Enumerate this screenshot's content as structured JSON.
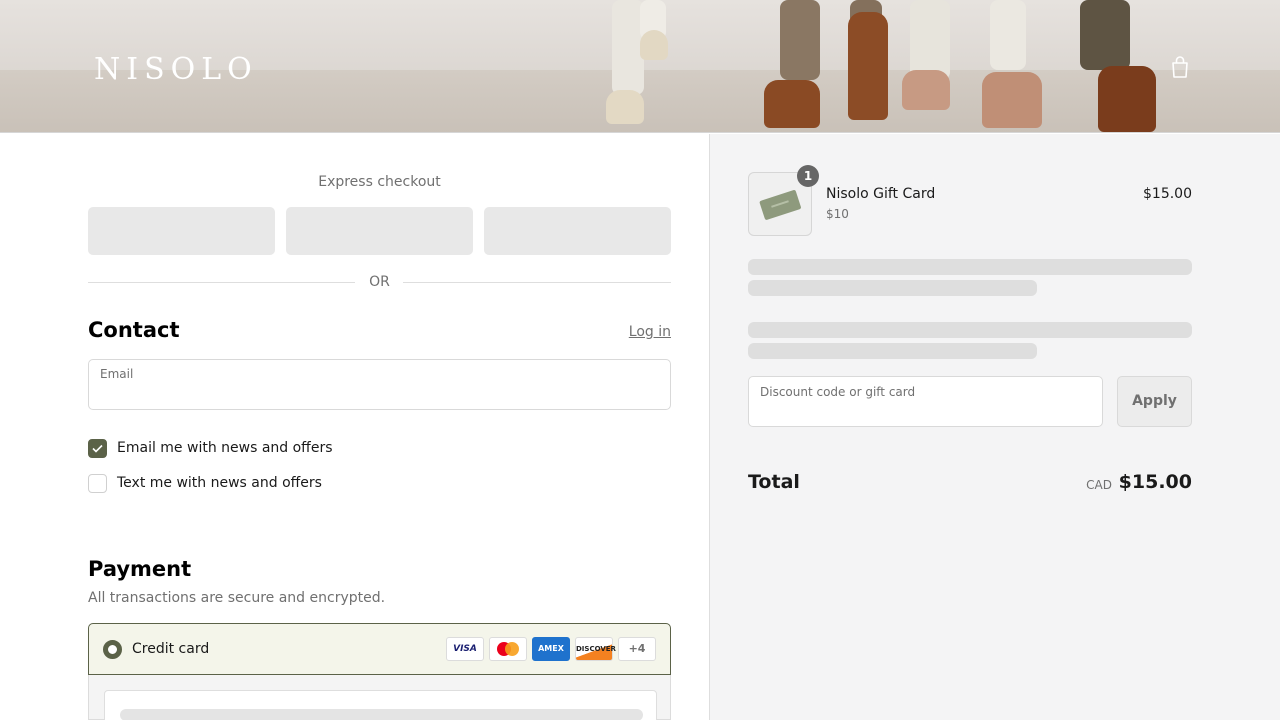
{
  "header": {
    "logo": "NISOLO",
    "cart_icon": "shopping-bag-icon"
  },
  "express": {
    "title": "Express checkout",
    "divider_text": "OR"
  },
  "contact": {
    "heading": "Contact",
    "login_label": "Log in",
    "email_label": "Email",
    "email_value": "",
    "checkboxes": [
      {
        "label": "Email me with news and offers",
        "checked": true
      },
      {
        "label": "Text me with news and offers",
        "checked": false
      }
    ]
  },
  "payment": {
    "heading": "Payment",
    "subtitle": "All transactions are secure and encrypted.",
    "method_label": "Credit card",
    "method_selected": true,
    "card_brands": [
      "VISA",
      "Mastercard",
      "AMEX",
      "DISCOVER"
    ],
    "more_brands": "+4"
  },
  "summary": {
    "item": {
      "name": "Nisolo Gift Card",
      "variant": "$10",
      "price": "$15.00",
      "quantity": "1"
    },
    "discount_placeholder": "Discount code or gift card",
    "apply_label": "Apply",
    "total_label": "Total",
    "total_currency": "CAD",
    "total_amount": "$15.00"
  },
  "colors": {
    "accent": "#5b6248",
    "panel_bg": "#f4f4f5",
    "selected_bg": "#f4f5ea"
  }
}
